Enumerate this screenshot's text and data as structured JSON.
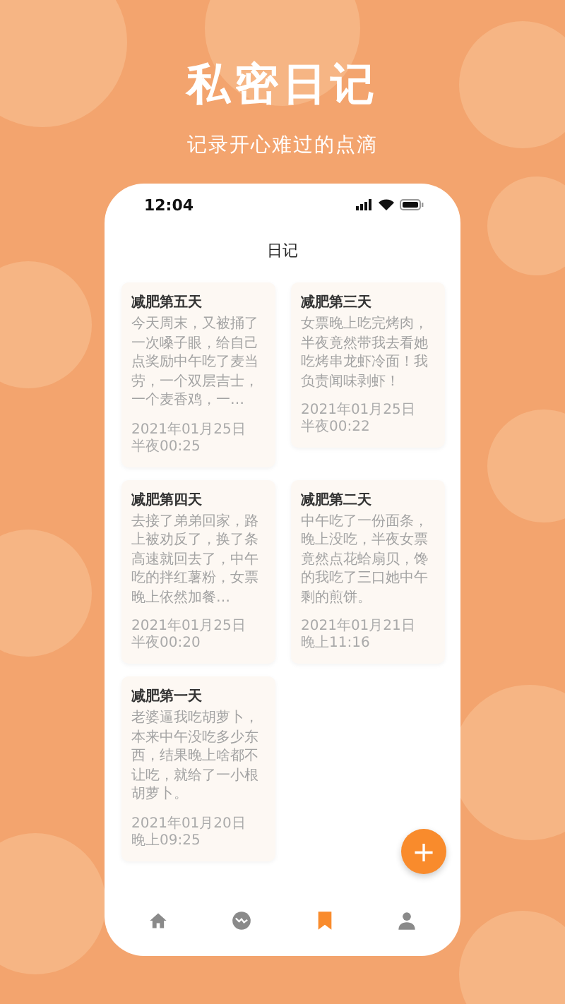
{
  "header": {
    "title": "私密日记",
    "subtitle": "记录开心难过的点滴"
  },
  "status_bar": {
    "time": "12:04"
  },
  "screen": {
    "title": "日记"
  },
  "entries": [
    {
      "title": "减肥第五天",
      "body": "今天周末，又被捅了一次嗓子眼，给自己点奖励中午吃了麦当劳，一个双层吉士，一个麦香鸡，一…",
      "date": "2021年01月25日",
      "time": "半夜00:25"
    },
    {
      "title": "减肥第三天",
      "body": "女票晚上吃完烤肉，半夜竟然带我去看她吃烤串龙虾冷面！我负责闻味剥虾！",
      "date": "2021年01月25日",
      "time": "半夜00:22"
    },
    {
      "title": "减肥第四天",
      "body": "去接了弟弟回家，路上被劝反了，换了条高速就回去了，中午吃的拌红薯粉，女票晚上依然加餐…",
      "date": "2021年01月25日",
      "time": "半夜00:20"
    },
    {
      "title": "减肥第二天",
      "body": "中午吃了一份面条，晚上没吃，半夜女票竟然点花蛤扇贝，馋的我吃了三口她中午剩的煎饼。",
      "date": "2021年01月21日",
      "time": "晚上11:16"
    },
    {
      "title": "减肥第一天",
      "body": "老婆逼我吃胡萝卜，本来中午没吃多少东西，结果晚上啥都不让吃，就给了一小根胡萝卜。",
      "date": "2021年01月20日",
      "time": "晚上09:25"
    }
  ],
  "fab": {
    "label": "+"
  },
  "tabs": [
    {
      "kind": "home",
      "selected": false
    },
    {
      "kind": "trend",
      "selected": false
    },
    {
      "kind": "bookmark",
      "selected": true
    },
    {
      "kind": "person",
      "selected": false
    }
  ]
}
